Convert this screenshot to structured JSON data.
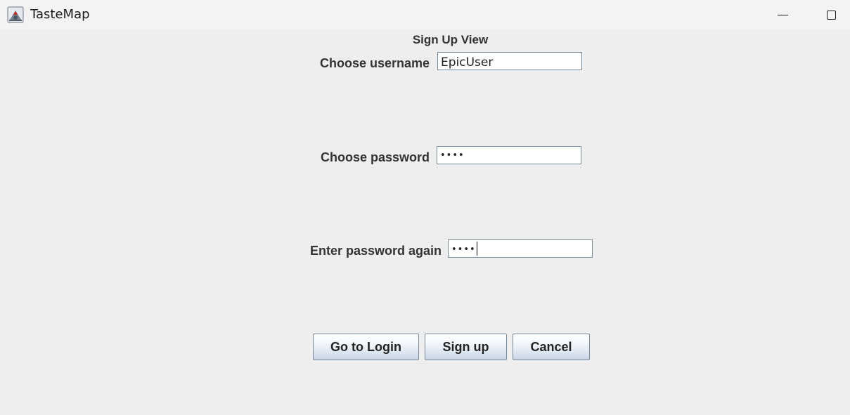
{
  "window": {
    "title": "TasteMap"
  },
  "view": {
    "title": "Sign Up View"
  },
  "form": {
    "username_label": "Choose username",
    "username_value": "EpicUser",
    "password_label": "Choose password",
    "password_value": "••••",
    "repeat_label": "Enter password again",
    "repeat_value": "••••"
  },
  "buttons": {
    "login": "Go to Login",
    "signup": "Sign up",
    "cancel": "Cancel"
  },
  "icons": {
    "app": "java-app-icon",
    "minimize": "minimize-icon",
    "maximize": "maximize-icon"
  }
}
